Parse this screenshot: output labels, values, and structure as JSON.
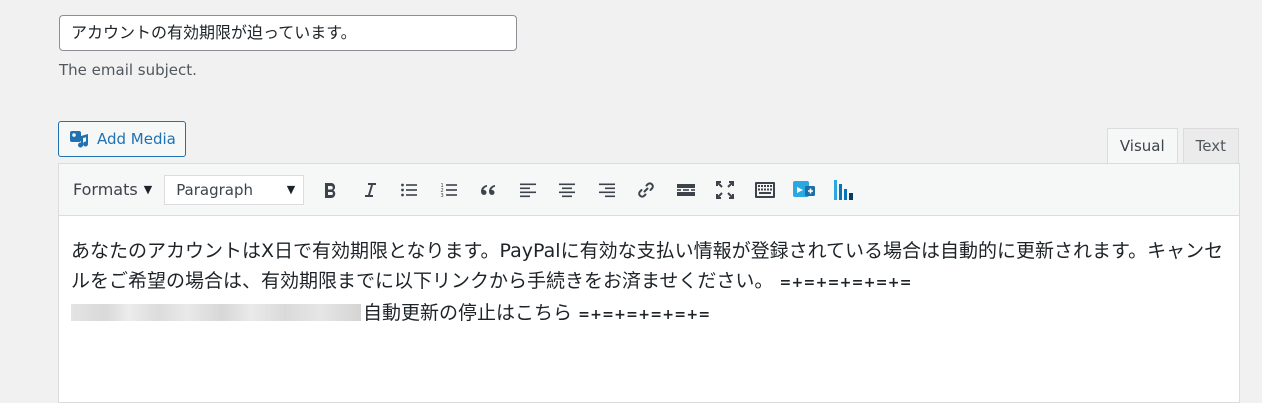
{
  "subject": {
    "value": "アカウントの有効期限が迫っています。",
    "description": "The email subject."
  },
  "media": {
    "add_media_label": "Add Media"
  },
  "editor": {
    "tabs": [
      {
        "label": "Visual",
        "active": true
      },
      {
        "label": "Text",
        "active": false
      }
    ],
    "toolbar": {
      "formats_label": "Formats",
      "block_format": "Paragraph",
      "buttons": [
        "bold-icon",
        "italic-icon",
        "bullet-list-icon",
        "numbered-list-icon",
        "blockquote-icon",
        "align-left-icon",
        "align-center-icon",
        "align-right-icon",
        "link-icon",
        "read-more-icon",
        "fullscreen-icon",
        "toolbar-toggle-icon",
        "plugin-icon",
        "chart-icon"
      ]
    },
    "content": {
      "paragraph1": "あなたのアカウントはX日で有効期限となります。PayPalに有効な支払い情報が登録されている場合は自動的に更新されます。キャンセルをご希望の場合は、有効期限までに以下リンクから手続きをお済ませください。",
      "separator1": "=+=+=+=+=+=",
      "link_text": "自動更新の停止はこちら",
      "separator2": "=+=+=+=+=+="
    }
  },
  "colors": {
    "link_blue": "#2271b1",
    "plugin_icon": "#2aa8e0",
    "chart_icon": "#0a73b8"
  }
}
